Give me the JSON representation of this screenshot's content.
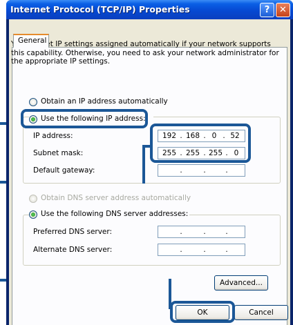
{
  "window": {
    "title": "Internet Protocol (TCP/IP) Properties",
    "help_glyph": "?",
    "close_glyph": "✕"
  },
  "tabs": [
    "General"
  ],
  "description": [
    "You can get IP settings assigned automatically if your network supports",
    "this capability. Otherwise, you need to ask your network administrator for",
    "the appropriate IP settings."
  ],
  "ip": {
    "auto_label": "Obtain an IP address automatically",
    "auto_selected": false,
    "manual_label": "Use the following IP address:",
    "manual_selected": true,
    "address_label": "IP address:",
    "address": [
      "192",
      "168",
      "0",
      "52"
    ],
    "mask_label": "Subnet mask:",
    "mask": [
      "255",
      "255",
      "255",
      "0"
    ],
    "gateway_label": "Default gateway:",
    "gateway": [
      "",
      "",
      "",
      ""
    ]
  },
  "dns": {
    "auto_label": "Obtain DNS server address automatically",
    "auto_selected": false,
    "auto_enabled": false,
    "manual_label": "Use the following DNS server addresses:",
    "manual_selected": true,
    "preferred_label": "Preferred DNS server:",
    "preferred": [
      "",
      "",
      "",
      ""
    ],
    "alternate_label": "Alternate DNS server:",
    "alternate": [
      "",
      "",
      "",
      ""
    ]
  },
  "buttons": {
    "advanced": "Advanced...",
    "ok": "OK",
    "cancel": "Cancel"
  },
  "colors": {
    "titlebar": "#0649d2",
    "dialog_bg": "#ece9d8",
    "highlight": "#1b5797",
    "selected_radio": "#21a121"
  }
}
